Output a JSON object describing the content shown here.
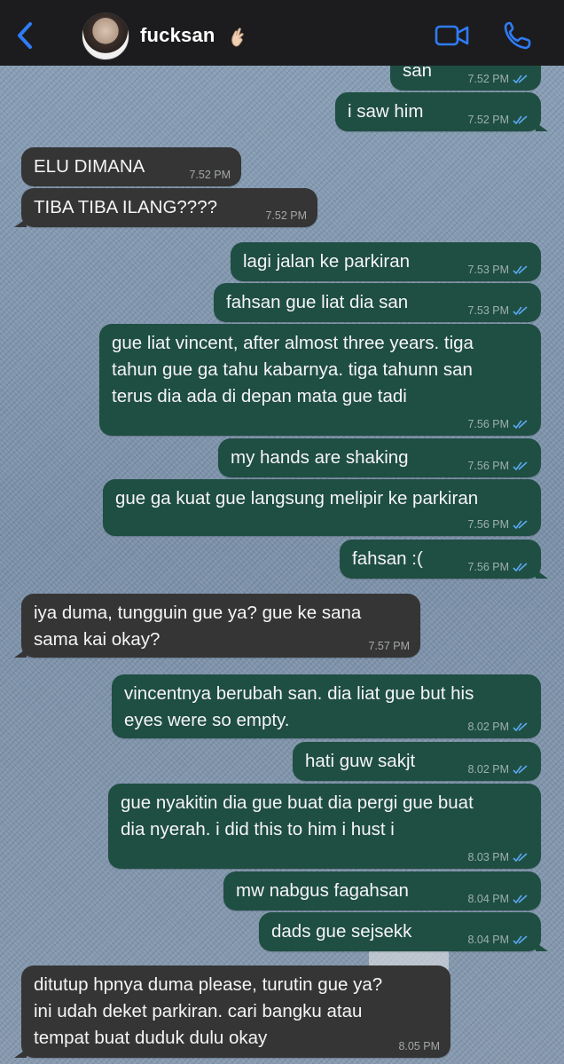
{
  "header": {
    "contact_name": "fucksan",
    "contact_emoji": "crossed-fingers-emoji",
    "back_icon": "chevron-left-icon",
    "video_icon": "video-camera-icon",
    "call_icon": "phone-icon",
    "accent_color": "#2f7cf6"
  },
  "colors": {
    "outgoing_bubble": "#1f4e43",
    "incoming_bubble": "#353535",
    "read_ticks": "#5aa9f0"
  },
  "messages": [
    {
      "dir": "out",
      "text": "san",
      "time": "7.52 PM",
      "read": true
    },
    {
      "dir": "out",
      "text": "i saw him",
      "time": "7.52 PM",
      "read": true
    },
    {
      "dir": "in",
      "text": "ELU DIMANA",
      "time": "7.52 PM"
    },
    {
      "dir": "in",
      "text": "TIBA TIBA ILANG????",
      "time": "7.52 PM"
    },
    {
      "dir": "out",
      "text": "lagi jalan ke parkiran",
      "time": "7.53 PM",
      "read": true
    },
    {
      "dir": "out",
      "text": "fahsan gue liat dia san",
      "time": "7.53 PM",
      "read": true
    },
    {
      "dir": "out",
      "text": "gue liat vincent, after almost three years. tiga\ntahun gue ga tahu kabarnya. tiga tahunn san\nterus dia ada di depan mata gue tadi",
      "time": "7.56 PM",
      "read": true
    },
    {
      "dir": "out",
      "text": "my hands are shaking",
      "time": "7.56 PM",
      "read": true
    },
    {
      "dir": "out",
      "text": "gue ga kuat gue langsung melipir ke parkiran",
      "time": "7.56 PM",
      "read": true
    },
    {
      "dir": "out",
      "text": "fahsan :(",
      "time": "7.56 PM",
      "read": true
    },
    {
      "dir": "in",
      "text": "iya duma, tungguin gue ya? gue ke sana\nsama kai okay?",
      "time": "7.57 PM"
    },
    {
      "dir": "out",
      "text": "vincentnya berubah san. dia liat gue but his\neyes were so empty.",
      "time": "8.02 PM",
      "read": true
    },
    {
      "dir": "out",
      "text": "hati guw sakjt",
      "time": "8.02 PM",
      "read": true
    },
    {
      "dir": "out",
      "text": "gue nyakitin dia gue buat dia pergi gue buat\ndia nyerah. i did this to him i hust i",
      "time": "8.03 PM",
      "read": true
    },
    {
      "dir": "out",
      "text": "mw nabgus fagahsan",
      "time": "8.04 PM",
      "read": true
    },
    {
      "dir": "out",
      "text": "dads gue sejsekk",
      "time": "8.04 PM",
      "read": true
    },
    {
      "dir": "in",
      "text": "ditutup hpnya duma please, turutin gue ya?\nini udah deket parkiran. cari bangku atau\ntempat buat duduk dulu okay",
      "time": "8.05 PM"
    }
  ]
}
